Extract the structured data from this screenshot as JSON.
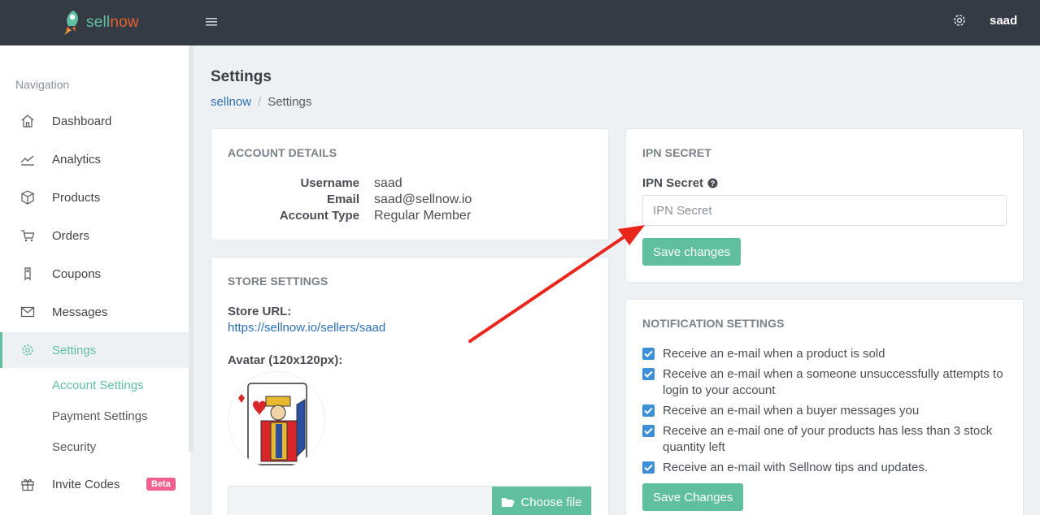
{
  "header": {
    "logo_text_a": "sell",
    "logo_text_b": "now",
    "user_name": "saad"
  },
  "sidebar": {
    "heading": "Navigation",
    "items": [
      {
        "label": "Dashboard",
        "icon": "home-icon"
      },
      {
        "label": "Analytics",
        "icon": "chart-line-icon"
      },
      {
        "label": "Products",
        "icon": "box-icon"
      },
      {
        "label": "Orders",
        "icon": "cart-icon"
      },
      {
        "label": "Coupons",
        "icon": "tag-icon"
      },
      {
        "label": "Messages",
        "icon": "envelope-icon"
      },
      {
        "label": "Settings",
        "icon": "gear-icon"
      }
    ],
    "sub_items": [
      "Account Settings",
      "Payment Settings",
      "Security"
    ],
    "invite_label": "Invite Codes",
    "beta_badge": "Beta"
  },
  "page": {
    "title": "Settings",
    "breadcrumb_root": "sellnow",
    "breadcrumb_sep": "/",
    "breadcrumb_current": "Settings"
  },
  "account": {
    "title": "ACCOUNT DETAILS",
    "rows": [
      {
        "key": "Username",
        "value": "saad"
      },
      {
        "key": "Email",
        "value": "saad@sellnow.io"
      },
      {
        "key": "Account Type",
        "value": "Regular Member"
      }
    ]
  },
  "store": {
    "title": "STORE SETTINGS",
    "url_label": "Store URL:",
    "url": "https://sellnow.io/sellers/saad",
    "avatar_label": "Avatar (120x120px):",
    "choose_file": "Choose file"
  },
  "ipn": {
    "title": "IPN SECRET",
    "label": "IPN Secret",
    "placeholder": "IPN Secret",
    "save": "Save changes"
  },
  "notifications": {
    "title": "NOTIFICATION SETTINGS",
    "options": [
      "Receive an e-mail when a product is sold",
      "Receive an e-mail when a someone unsuccessfully attempts to login to your account",
      "Receive an e-mail when a buyer messages you",
      "Receive an e-mail one of your products has less than 3 stock quantity left",
      "Receive an e-mail with Sellnow tips and updates."
    ],
    "save": "Save Changes"
  },
  "colors": {
    "accent": "#5fbf9f",
    "topbar": "#353b44",
    "link": "#2d6fb3",
    "checkbox": "#3d8fd6",
    "annotation_arrow": "#e8261c"
  }
}
